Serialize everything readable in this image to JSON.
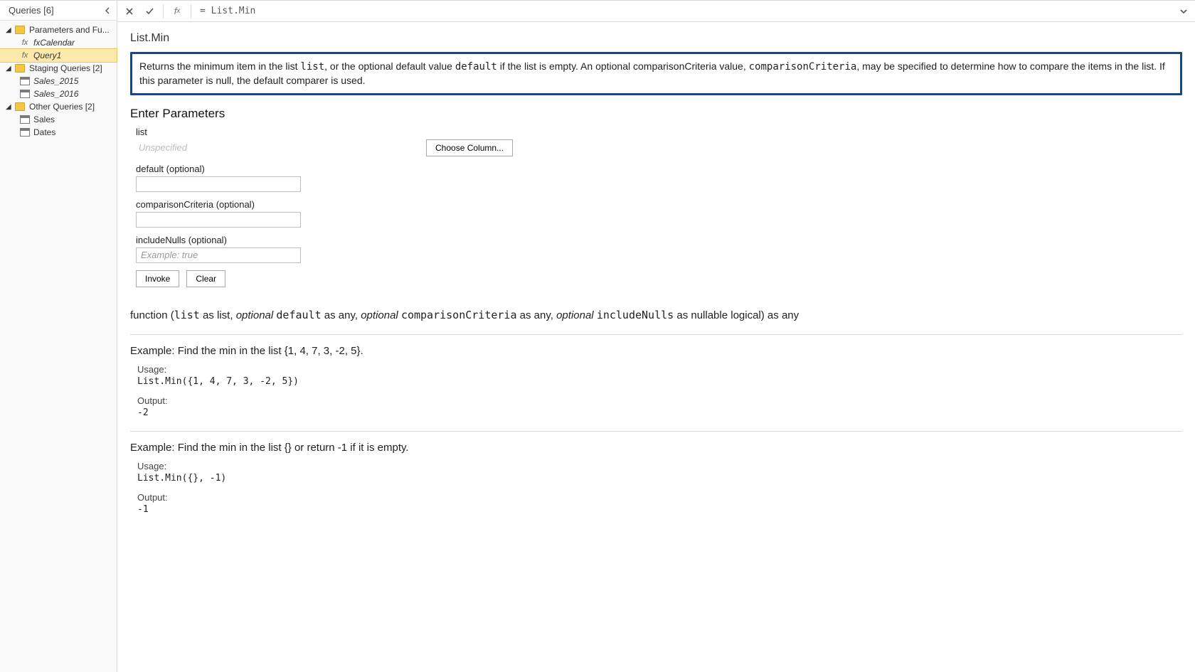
{
  "sidebar": {
    "title": "Queries [6]",
    "groups": [
      {
        "label": "Parameters and Fu...",
        "items": [
          {
            "type": "fx",
            "label": "fxCalendar",
            "selected": false
          },
          {
            "type": "fx",
            "label": "Query1",
            "selected": true
          }
        ]
      },
      {
        "label": "Staging Queries [2]",
        "items": [
          {
            "type": "table",
            "label": "Sales_2015"
          },
          {
            "type": "table",
            "label": "Sales_2016"
          }
        ]
      },
      {
        "label": "Other Queries [2]",
        "items": [
          {
            "type": "table",
            "label": "Sales"
          },
          {
            "type": "table",
            "label": "Dates"
          }
        ]
      }
    ]
  },
  "formula_bar": {
    "value": "= List.Min"
  },
  "doc": {
    "fn_name": "List.Min",
    "description_parts": {
      "p1": "Returns the minimum item in the list ",
      "c1": "list",
      "p2": ", or the optional default value ",
      "c2": "default",
      "p3": " if the list is empty. An optional comparisonCriteria value, ",
      "c3": "comparisonCriteria",
      "p4": ", may be specified to determine how to compare the items in the list. If this parameter is null, the default comparer is used."
    },
    "enter_params_title": "Enter Parameters",
    "params": {
      "list_label": "list",
      "list_unspec": "Unspecified",
      "choose_column": "Choose Column...",
      "default_label": "default (optional)",
      "comparison_label": "comparisonCriteria (optional)",
      "includeNulls_label": "includeNulls (optional)",
      "includeNulls_placeholder": "Example: true"
    },
    "buttons": {
      "invoke": "Invoke",
      "clear": "Clear"
    },
    "signature": {
      "fn": "function (",
      "p_list": "list",
      "as_list": " as list, ",
      "opt": "optional ",
      "p_default": "default",
      "as_any1": " as any, ",
      "p_comparison": "comparisonCriteria",
      "as_any2": " as any, ",
      "p_includeNulls": "includeNulls",
      "tail": " as nullable logical) as any"
    },
    "examples": [
      {
        "title": "Example: Find the min in the list {1, 4, 7, 3, -2, 5}.",
        "usage_label": "Usage:",
        "usage_code": "List.Min({1, 4, 7, 3, -2, 5})",
        "output_label": "Output:",
        "output_code": "-2"
      },
      {
        "title": "Example: Find the min in the list {} or return -1 if it is empty.",
        "usage_label": "Usage:",
        "usage_code": "List.Min({}, -1)",
        "output_label": "Output:",
        "output_code": "-1"
      }
    ]
  }
}
